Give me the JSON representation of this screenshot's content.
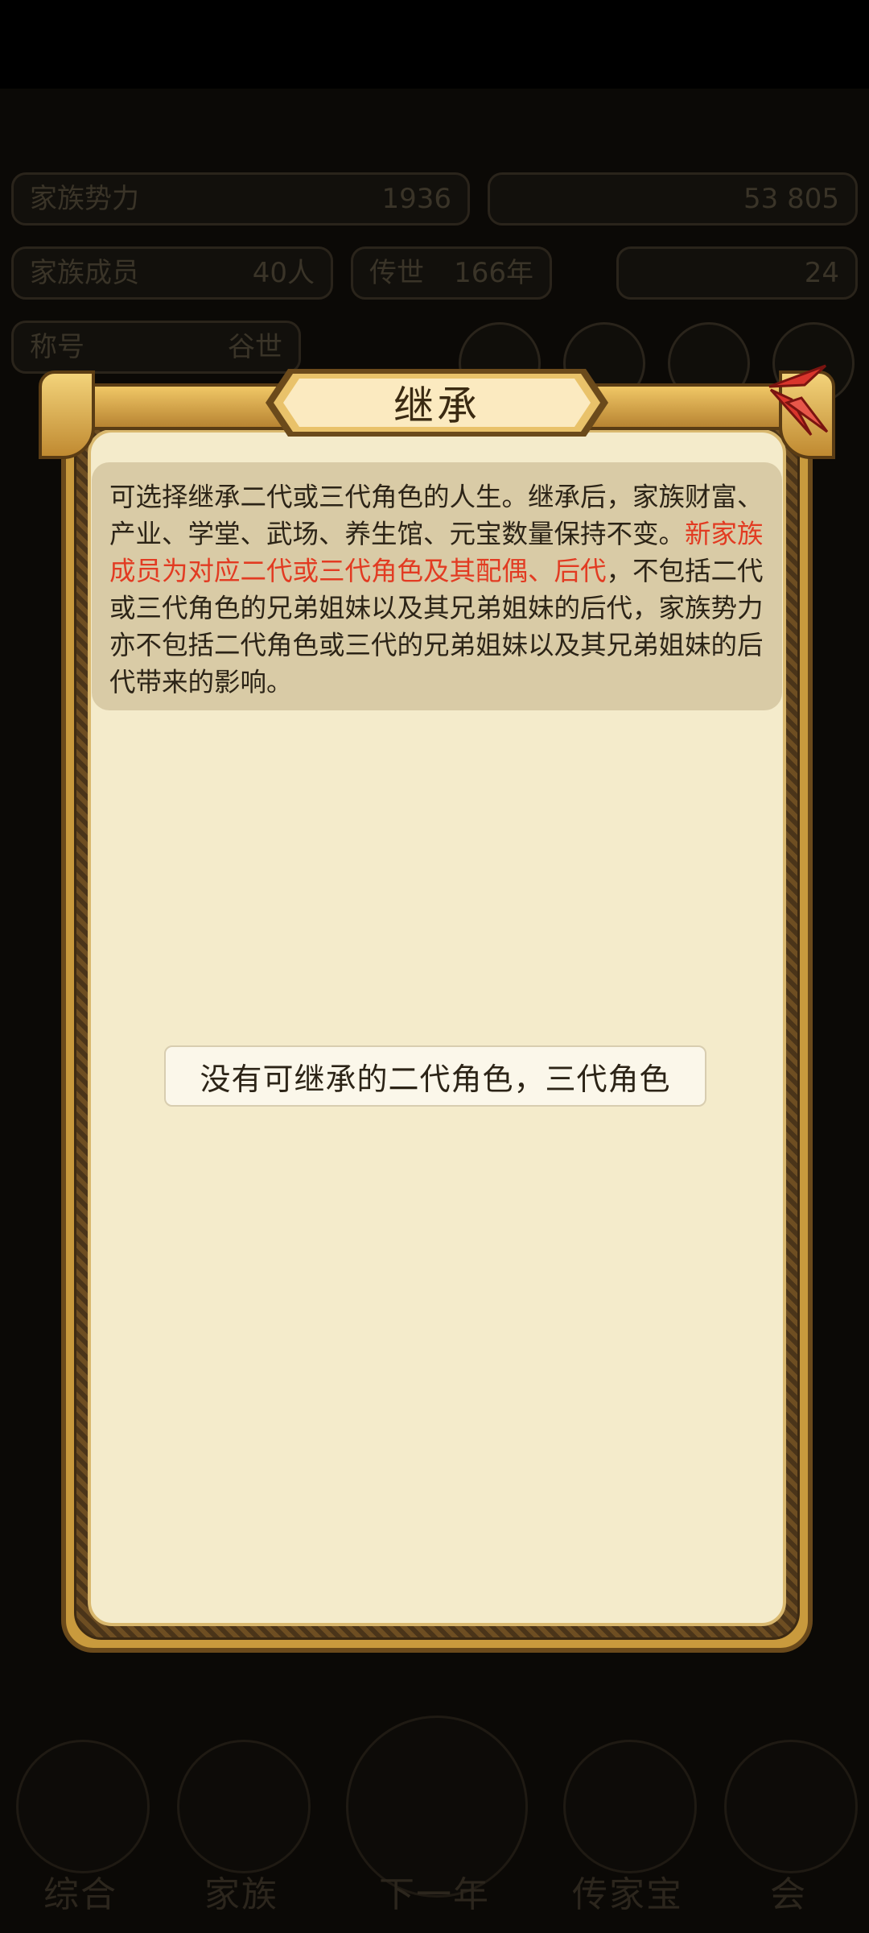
{
  "background": {
    "pills": [
      {
        "label": "家族势力",
        "value": "1936"
      },
      {
        "label": "",
        "value": "53  805"
      },
      {
        "label": "家族成员",
        "value": "40人"
      },
      {
        "label": "传世",
        "value": "166年"
      },
      {
        "label": "",
        "value": "24"
      },
      {
        "label": "称号",
        "value": "谷世"
      }
    ],
    "nav": [
      "综合",
      "家族",
      "下一年",
      "传家宝",
      "会"
    ]
  },
  "modal": {
    "title": "继承",
    "info_text_1": "可选择继承二代或三代角色的人生。继承后，家族财富、产业、学堂、武场、养生馆、元宝数量保持不变。",
    "info_text_red": "新家族成员为对应二代或三代角色及其配偶、后代",
    "info_text_2": "，不包括二代或三代角色的兄弟姐妹以及其兄弟姐妹的后代，家族势力亦不包括二代角色或三代的兄弟姐妹以及其兄弟姐妹的后代带来的影响。",
    "empty_message": "没有可继承的二代角色，三代角色"
  },
  "colors": {
    "parchment": "#f4ebcb",
    "gold": "#c99a3d",
    "info_bg": "#d9cba6",
    "highlight_red": "#e23b22",
    "close_red": "#d9352c"
  }
}
